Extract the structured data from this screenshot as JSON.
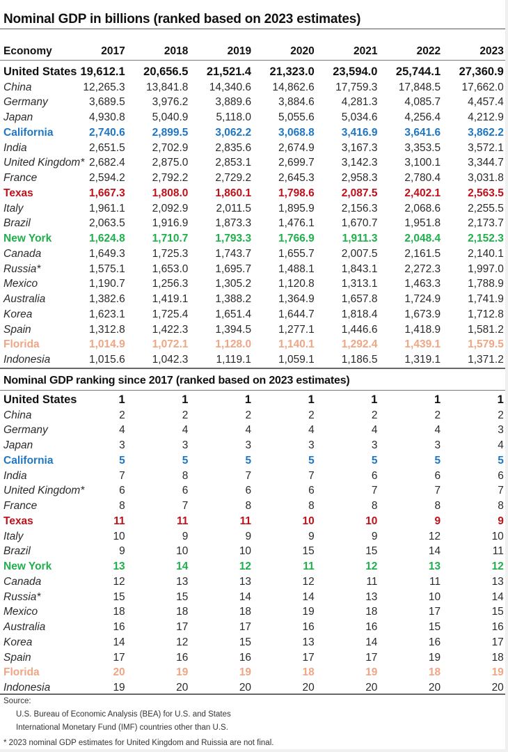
{
  "gdp_table": {
    "title": "Nominal GDP in billions (ranked based on 2023 estimates)",
    "header": {
      "economy": "Economy",
      "years": [
        "2017",
        "2018",
        "2019",
        "2020",
        "2021",
        "2022",
        "2023"
      ]
    },
    "rows": [
      {
        "name": "United States",
        "style": "us",
        "values": [
          "19,612.1",
          "20,656.5",
          "21,521.4",
          "21,323.0",
          "23,594.0",
          "25,744.1",
          "27,360.9"
        ]
      },
      {
        "name": "China",
        "style": "",
        "values": [
          "12,265.3",
          "13,841.8",
          "14,340.6",
          "14,862.6",
          "17,759.3",
          "17,848.5",
          "17,662.0"
        ]
      },
      {
        "name": "Germany",
        "style": "",
        "values": [
          "3,689.5",
          "3,976.2",
          "3,889.6",
          "3,884.6",
          "4,281.3",
          "4,085.7",
          "4,457.4"
        ]
      },
      {
        "name": "Japan",
        "style": "",
        "values": [
          "4,930.8",
          "5,040.9",
          "5,118.0",
          "5,055.6",
          "5,034.6",
          "4,256.4",
          "4,212.9"
        ]
      },
      {
        "name": "California",
        "style": "ca",
        "values": [
          "2,740.6",
          "2,899.5",
          "3,062.2",
          "3,068.8",
          "3,416.9",
          "3,641.6",
          "3,862.2"
        ]
      },
      {
        "name": "India",
        "style": "",
        "values": [
          "2,651.5",
          "2,702.9",
          "2,835.6",
          "2,674.9",
          "3,167.3",
          "3,353.5",
          "3,572.1"
        ]
      },
      {
        "name": "United Kingdom*",
        "style": "",
        "values": [
          "2,682.4",
          "2,875.0",
          "2,853.1",
          "2,699.7",
          "3,142.3",
          "3,100.1",
          "3,344.7"
        ]
      },
      {
        "name": "France",
        "style": "",
        "values": [
          "2,594.2",
          "2,792.2",
          "2,729.2",
          "2,645.3",
          "2,958.3",
          "2,780.4",
          "3,031.8"
        ]
      },
      {
        "name": "Texas",
        "style": "tx",
        "values": [
          "1,667.3",
          "1,808.0",
          "1,860.1",
          "1,798.6",
          "2,087.5",
          "2,402.1",
          "2,563.5"
        ]
      },
      {
        "name": "Italy",
        "style": "",
        "values": [
          "1,961.1",
          "2,092.9",
          "2,011.5",
          "1,895.9",
          "2,156.3",
          "2,068.6",
          "2,255.5"
        ]
      },
      {
        "name": "Brazil",
        "style": "",
        "values": [
          "2,063.5",
          "1,916.9",
          "1,873.3",
          "1,476.1",
          "1,670.7",
          "1,951.8",
          "2,173.7"
        ]
      },
      {
        "name": "New York",
        "style": "ny",
        "values": [
          "1,624.8",
          "1,710.7",
          "1,793.3",
          "1,766.9",
          "1,911.3",
          "2,048.4",
          "2,152.3"
        ]
      },
      {
        "name": "Canada",
        "style": "",
        "values": [
          "1,649.3",
          "1,725.3",
          "1,743.7",
          "1,655.7",
          "2,007.5",
          "2,161.5",
          "2,140.1"
        ]
      },
      {
        "name": "Russia*",
        "style": "",
        "values": [
          "1,575.1",
          "1,653.0",
          "1,695.7",
          "1,488.1",
          "1,843.1",
          "2,272.3",
          "1,997.0"
        ]
      },
      {
        "name": "Mexico",
        "style": "",
        "values": [
          "1,190.7",
          "1,256.3",
          "1,305.2",
          "1,120.8",
          "1,313.1",
          "1,463.3",
          "1,788.9"
        ]
      },
      {
        "name": "Australia",
        "style": "",
        "values": [
          "1,382.6",
          "1,419.1",
          "1,388.2",
          "1,364.9",
          "1,657.8",
          "1,724.9",
          "1,741.9"
        ]
      },
      {
        "name": "Korea",
        "style": "",
        "values": [
          "1,623.1",
          "1,725.4",
          "1,651.4",
          "1,644.7",
          "1,818.4",
          "1,673.9",
          "1,712.8"
        ]
      },
      {
        "name": "Spain",
        "style": "",
        "values": [
          "1,312.8",
          "1,422.3",
          "1,394.5",
          "1,277.1",
          "1,446.6",
          "1,418.9",
          "1,581.2"
        ]
      },
      {
        "name": "Florida",
        "style": "fl",
        "values": [
          "1,014.9",
          "1,072.1",
          "1,128.0",
          "1,140.1",
          "1,292.4",
          "1,439.1",
          "1,579.5"
        ]
      },
      {
        "name": "Indonesia",
        "style": "",
        "values": [
          "1,015.6",
          "1,042.3",
          "1,119.1",
          "1,059.1",
          "1,186.5",
          "1,319.1",
          "1,371.2"
        ]
      }
    ]
  },
  "rank_table": {
    "title": "Nominal GDP ranking since 2017 (ranked based on 2023 estimates)",
    "rows": [
      {
        "name": "United States",
        "style": "us",
        "values": [
          "1",
          "1",
          "1",
          "1",
          "1",
          "1",
          "1"
        ]
      },
      {
        "name": "China",
        "style": "",
        "values": [
          "2",
          "2",
          "2",
          "2",
          "2",
          "2",
          "2"
        ]
      },
      {
        "name": "Germany",
        "style": "",
        "values": [
          "4",
          "4",
          "4",
          "4",
          "4",
          "4",
          "3"
        ]
      },
      {
        "name": "Japan",
        "style": "",
        "values": [
          "3",
          "3",
          "3",
          "3",
          "3",
          "3",
          "4"
        ]
      },
      {
        "name": "California",
        "style": "ca",
        "values": [
          "5",
          "5",
          "5",
          "5",
          "5",
          "5",
          "5"
        ]
      },
      {
        "name": "India",
        "style": "",
        "values": [
          "7",
          "8",
          "7",
          "7",
          "6",
          "6",
          "6"
        ]
      },
      {
        "name": "United Kingdom*",
        "style": "",
        "values": [
          "6",
          "6",
          "6",
          "6",
          "7",
          "7",
          "7"
        ]
      },
      {
        "name": "France",
        "style": "",
        "values": [
          "8",
          "7",
          "8",
          "8",
          "8",
          "8",
          "8"
        ]
      },
      {
        "name": "Texas",
        "style": "tx",
        "values": [
          "11",
          "11",
          "11",
          "10",
          "10",
          "9",
          "9"
        ]
      },
      {
        "name": "Italy",
        "style": "",
        "values": [
          "10",
          "9",
          "9",
          "9",
          "9",
          "12",
          "10"
        ]
      },
      {
        "name": "Brazil",
        "style": "",
        "values": [
          "9",
          "10",
          "10",
          "15",
          "15",
          "14",
          "11"
        ]
      },
      {
        "name": "New York",
        "style": "ny",
        "values": [
          "13",
          "14",
          "12",
          "11",
          "12",
          "13",
          "12"
        ]
      },
      {
        "name": "Canada",
        "style": "",
        "values": [
          "12",
          "13",
          "13",
          "12",
          "11",
          "11",
          "13"
        ]
      },
      {
        "name": "Russia*",
        "style": "",
        "values": [
          "15",
          "15",
          "14",
          "14",
          "13",
          "10",
          "14"
        ]
      },
      {
        "name": "Mexico",
        "style": "",
        "values": [
          "18",
          "18",
          "18",
          "19",
          "18",
          "17",
          "15"
        ]
      },
      {
        "name": "Australia",
        "style": "",
        "values": [
          "16",
          "17",
          "17",
          "16",
          "16",
          "15",
          "16"
        ]
      },
      {
        "name": "Korea",
        "style": "",
        "values": [
          "14",
          "12",
          "15",
          "13",
          "14",
          "16",
          "17"
        ]
      },
      {
        "name": "Spain",
        "style": "",
        "values": [
          "17",
          "16",
          "16",
          "17",
          "17",
          "19",
          "18"
        ]
      },
      {
        "name": "Florida",
        "style": "fl",
        "values": [
          "20",
          "19",
          "19",
          "18",
          "19",
          "18",
          "19"
        ]
      },
      {
        "name": "Indonesia",
        "style": "",
        "values": [
          "19",
          "20",
          "20",
          "20",
          "20",
          "20",
          "20"
        ]
      }
    ]
  },
  "footer": {
    "source_label": "Source:",
    "source_lines": [
      "U.S. Bureau of Economic Analysis (BEA) for U.S. and States",
      "International Monetary Fund (IMF) countries other than U.S."
    ],
    "note": "* 2023 nominal GDP estimates for United Kingdom and Ruissia are not final."
  },
  "colors": {
    "california": "#1f77c4",
    "texas": "#c0101a",
    "new_york": "#1fb04c",
    "florida": "#f0a585"
  }
}
